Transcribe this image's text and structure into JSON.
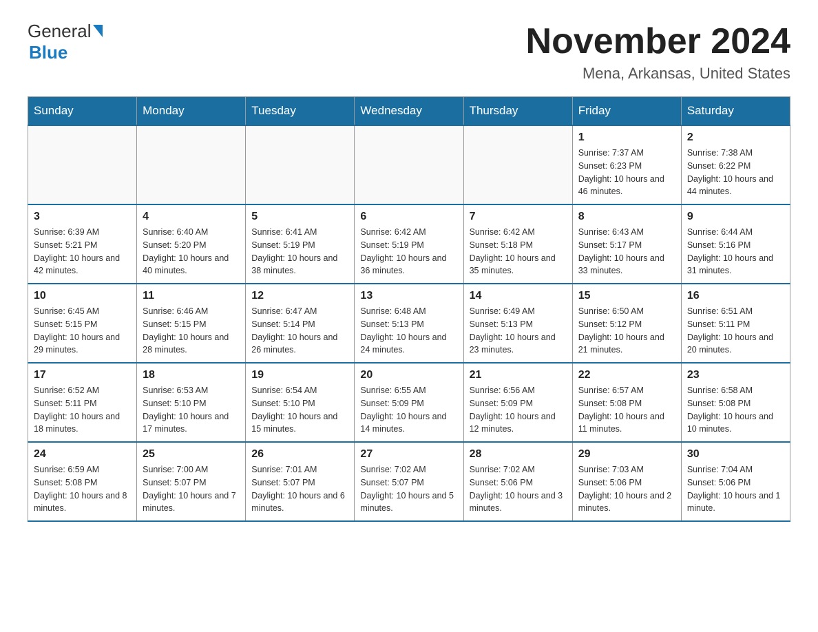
{
  "logo": {
    "general": "General",
    "blue": "Blue"
  },
  "title": "November 2024",
  "location": "Mena, Arkansas, United States",
  "days_header": [
    "Sunday",
    "Monday",
    "Tuesday",
    "Wednesday",
    "Thursday",
    "Friday",
    "Saturday"
  ],
  "weeks": [
    [
      {
        "day": "",
        "info": ""
      },
      {
        "day": "",
        "info": ""
      },
      {
        "day": "",
        "info": ""
      },
      {
        "day": "",
        "info": ""
      },
      {
        "day": "",
        "info": ""
      },
      {
        "day": "1",
        "info": "Sunrise: 7:37 AM\nSunset: 6:23 PM\nDaylight: 10 hours and 46 minutes."
      },
      {
        "day": "2",
        "info": "Sunrise: 7:38 AM\nSunset: 6:22 PM\nDaylight: 10 hours and 44 minutes."
      }
    ],
    [
      {
        "day": "3",
        "info": "Sunrise: 6:39 AM\nSunset: 5:21 PM\nDaylight: 10 hours and 42 minutes."
      },
      {
        "day": "4",
        "info": "Sunrise: 6:40 AM\nSunset: 5:20 PM\nDaylight: 10 hours and 40 minutes."
      },
      {
        "day": "5",
        "info": "Sunrise: 6:41 AM\nSunset: 5:19 PM\nDaylight: 10 hours and 38 minutes."
      },
      {
        "day": "6",
        "info": "Sunrise: 6:42 AM\nSunset: 5:19 PM\nDaylight: 10 hours and 36 minutes."
      },
      {
        "day": "7",
        "info": "Sunrise: 6:42 AM\nSunset: 5:18 PM\nDaylight: 10 hours and 35 minutes."
      },
      {
        "day": "8",
        "info": "Sunrise: 6:43 AM\nSunset: 5:17 PM\nDaylight: 10 hours and 33 minutes."
      },
      {
        "day": "9",
        "info": "Sunrise: 6:44 AM\nSunset: 5:16 PM\nDaylight: 10 hours and 31 minutes."
      }
    ],
    [
      {
        "day": "10",
        "info": "Sunrise: 6:45 AM\nSunset: 5:15 PM\nDaylight: 10 hours and 29 minutes."
      },
      {
        "day": "11",
        "info": "Sunrise: 6:46 AM\nSunset: 5:15 PM\nDaylight: 10 hours and 28 minutes."
      },
      {
        "day": "12",
        "info": "Sunrise: 6:47 AM\nSunset: 5:14 PM\nDaylight: 10 hours and 26 minutes."
      },
      {
        "day": "13",
        "info": "Sunrise: 6:48 AM\nSunset: 5:13 PM\nDaylight: 10 hours and 24 minutes."
      },
      {
        "day": "14",
        "info": "Sunrise: 6:49 AM\nSunset: 5:13 PM\nDaylight: 10 hours and 23 minutes."
      },
      {
        "day": "15",
        "info": "Sunrise: 6:50 AM\nSunset: 5:12 PM\nDaylight: 10 hours and 21 minutes."
      },
      {
        "day": "16",
        "info": "Sunrise: 6:51 AM\nSunset: 5:11 PM\nDaylight: 10 hours and 20 minutes."
      }
    ],
    [
      {
        "day": "17",
        "info": "Sunrise: 6:52 AM\nSunset: 5:11 PM\nDaylight: 10 hours and 18 minutes."
      },
      {
        "day": "18",
        "info": "Sunrise: 6:53 AM\nSunset: 5:10 PM\nDaylight: 10 hours and 17 minutes."
      },
      {
        "day": "19",
        "info": "Sunrise: 6:54 AM\nSunset: 5:10 PM\nDaylight: 10 hours and 15 minutes."
      },
      {
        "day": "20",
        "info": "Sunrise: 6:55 AM\nSunset: 5:09 PM\nDaylight: 10 hours and 14 minutes."
      },
      {
        "day": "21",
        "info": "Sunrise: 6:56 AM\nSunset: 5:09 PM\nDaylight: 10 hours and 12 minutes."
      },
      {
        "day": "22",
        "info": "Sunrise: 6:57 AM\nSunset: 5:08 PM\nDaylight: 10 hours and 11 minutes."
      },
      {
        "day": "23",
        "info": "Sunrise: 6:58 AM\nSunset: 5:08 PM\nDaylight: 10 hours and 10 minutes."
      }
    ],
    [
      {
        "day": "24",
        "info": "Sunrise: 6:59 AM\nSunset: 5:08 PM\nDaylight: 10 hours and 8 minutes."
      },
      {
        "day": "25",
        "info": "Sunrise: 7:00 AM\nSunset: 5:07 PM\nDaylight: 10 hours and 7 minutes."
      },
      {
        "day": "26",
        "info": "Sunrise: 7:01 AM\nSunset: 5:07 PM\nDaylight: 10 hours and 6 minutes."
      },
      {
        "day": "27",
        "info": "Sunrise: 7:02 AM\nSunset: 5:07 PM\nDaylight: 10 hours and 5 minutes."
      },
      {
        "day": "28",
        "info": "Sunrise: 7:02 AM\nSunset: 5:06 PM\nDaylight: 10 hours and 3 minutes."
      },
      {
        "day": "29",
        "info": "Sunrise: 7:03 AM\nSunset: 5:06 PM\nDaylight: 10 hours and 2 minutes."
      },
      {
        "day": "30",
        "info": "Sunrise: 7:04 AM\nSunset: 5:06 PM\nDaylight: 10 hours and 1 minute."
      }
    ]
  ]
}
